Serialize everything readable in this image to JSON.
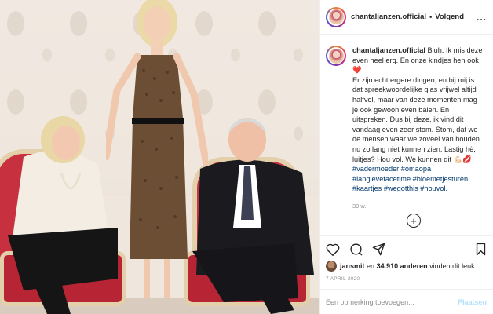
{
  "post": {
    "username": "chantaljanzen.official",
    "separator": "•",
    "follow_label": "Volgend",
    "more_label": "...",
    "caption_user": "chantaljanzen.official",
    "caption_text_1": "Bluh. Ik mis deze even heel erg. En onze kindjes hen ook",
    "heart": "❤️",
    "caption_text_2": "Er zijn echt ergere dingen, en bij mij is dat spreekwoordelijke glas vrijwel altijd halfvol, maar van deze momenten mag je ook gewoon even balen. En uitspreken. Dus bij deze, ik vind dit vandaag even zeer stom. Stom, dat we de mensen waar we zoveel van houden nu zo lang niet kunnen zien. Lastig hè, luitjes? Hou vol. We kunnen dit",
    "caption_emoji": "💪🏻💋",
    "hashtags": "#vadermoeder #omaopa #langlevefacetime #bloemetjesturen #kaartjes #wegotthis #houvol.",
    "time_ago": "39 w.",
    "plus": "+",
    "likes_user": "jansmit",
    "likes_and": "en",
    "likes_count": "34.910 anderen",
    "likes_suffix": "vinden dit leuk",
    "date": "7 APRIL 2020",
    "comment_placeholder": "Een opmerking toevoegen...",
    "post_label": "Plaatsen"
  },
  "icons": [
    "heart-icon",
    "comment-icon",
    "share-icon",
    "bookmark-icon"
  ]
}
